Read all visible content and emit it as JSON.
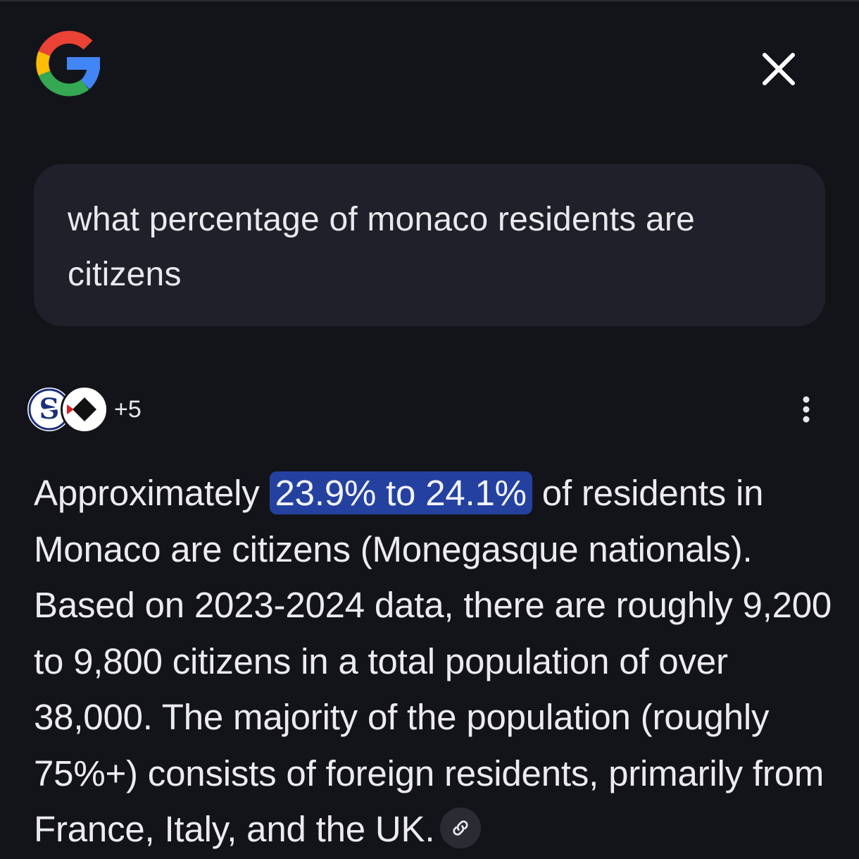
{
  "header": {
    "logo_icon": "google-g-logo",
    "close_icon": "close-icon"
  },
  "query": {
    "text": "what percentage of monaco residents are citizens"
  },
  "sources": {
    "more_count": "+5",
    "avatars": [
      "source-s-logo",
      "source-diamond-logo"
    ]
  },
  "answer": {
    "prefix": "Approximately ",
    "highlight": "23.9% to 24.1%",
    "body": " of residents in Monaco are citizens (Monegasque nationals). Based on 2023-2024 data, there are roughly 9,200 to 9,800 citizens in a total population of over 38,000. The majority of the population (roughly 75%+) consists of foreign residents, primarily from France, Italy, and the UK.",
    "link_icon": "link-icon"
  },
  "colors": {
    "background": "#13141a",
    "bubble": "#1f2029",
    "highlight": "#2541a0",
    "google_blue": "#4285F4",
    "google_red": "#EA4335",
    "google_yellow": "#FBBC05",
    "google_green": "#34A853"
  }
}
